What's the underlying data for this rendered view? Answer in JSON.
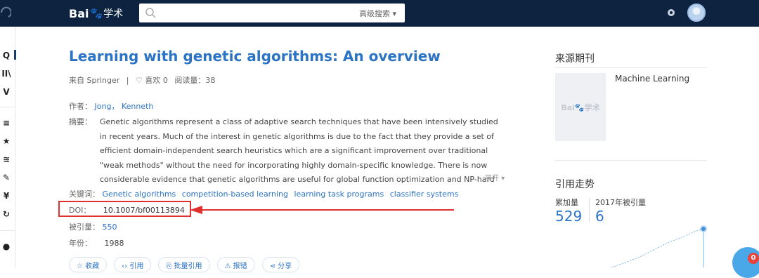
{
  "header": {
    "logo_text": "Bai",
    "logo_paw": "🐾",
    "logo_sub": "学术",
    "search_placeholder": "",
    "advanced_search": "高级搜索 ▾"
  },
  "paper": {
    "title": "Learning with genetic algorithms: An overview",
    "source": "来自 Springer",
    "likes": "♡ 喜欢 0",
    "reads": "阅读量：38",
    "authors_label": "作者：",
    "authors": [
      "Jong",
      "Kenneth"
    ],
    "abstract_label": "摘要：",
    "abstract": "Genetic algorithms represent a class of adaptive search techniques that have been intensively studied in recent years. Much of the interest in genetic algorithms is due to the fact that they provide a set of efficient domain-independent search heuristics which are a significant improvement over traditional \"weak methods\" without the need for incorporating highly domain-specific knowledge. There is now considerable evidence that genetic algorithms are useful for global function optimization and NP-hard problems. Recently, there has been a",
    "expand": "展开 ▾",
    "keywords_label": "关键词：",
    "keywords": [
      "Genetic algorithms",
      "competition-based learning",
      "learning task programs",
      "classifier systems"
    ],
    "doi_label": "DOI：",
    "doi": "10.1007/bf00113894",
    "cited_label": "被引量：",
    "cited": "550",
    "year_label": "年份：",
    "year": "1988"
  },
  "actions": [
    "☆ 收藏",
    "‹› 引用",
    "⎘ 批量引用",
    "⚠ 报错",
    "⋖ 分享"
  ],
  "sidebar": {
    "journal_title": "来源期刊",
    "journal_cover": "Bai🐾学术",
    "journal_name": "Machine Learning",
    "trend_title": "引用走势",
    "total_label": "累加量",
    "total_value": "529",
    "year_label": "2017年被引量",
    "year_value": "6"
  },
  "left_nav": [
    "Q",
    "II\\",
    "V",
    "≡",
    "★",
    "≋",
    "✎",
    "¥",
    "↻",
    "●"
  ],
  "float_badge": "0",
  "colors": {
    "header_bg": "#0d2340",
    "link": "#2b73c4",
    "highlight": "#e03030"
  }
}
